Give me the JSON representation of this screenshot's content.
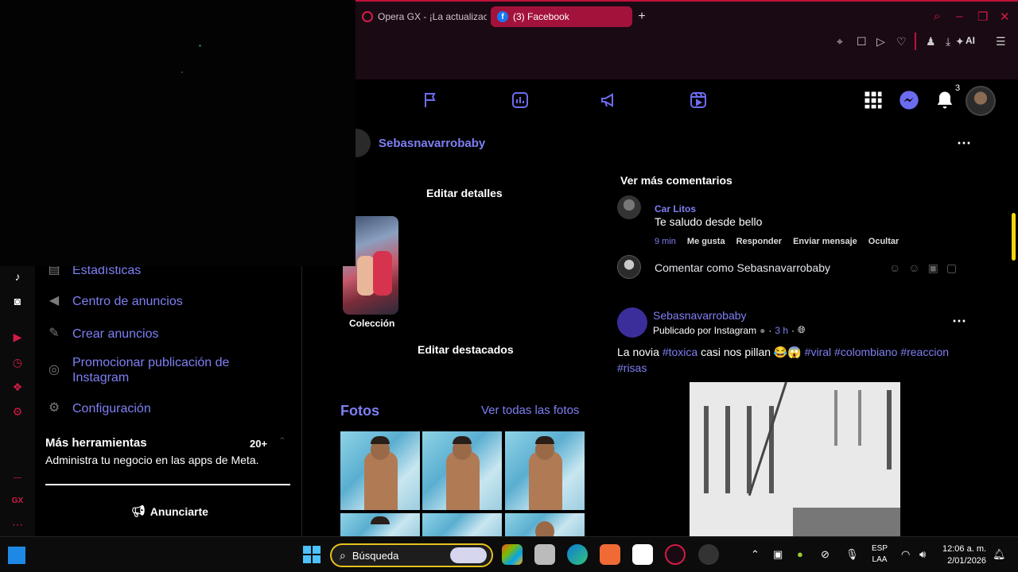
{
  "browser": {
    "tabs": [
      {
        "label": "Opera GX - ¡La actualizació"
      },
      {
        "label": "(3) Facebook",
        "active": true
      }
    ],
    "toolbar_ai_label": "AI",
    "accent_color": "#c0113a"
  },
  "facebook": {
    "nav_icons": [
      "flag-icon",
      "insights-icon",
      "megaphone-icon",
      "reels-icon"
    ],
    "notification_count": "3",
    "profile_name": "Sebasnavarrobaby",
    "edit_details": "Editar detalles",
    "collection_label": "Colección",
    "edit_highlights": "Editar destacados",
    "photos": {
      "title": "Fotos",
      "see_all": "Ver todas las fotos"
    },
    "comments": {
      "see_more": "Ver más comentarios",
      "items": [
        {
          "author": "Car Litos",
          "text": "Te saludo desde bello",
          "time": "9 min",
          "actions": [
            "Me gusta",
            "Responder",
            "Enviar mensaje",
            "Ocultar"
          ]
        }
      ],
      "composer_placeholder": "Comentar como Sebasnavarrobaby"
    },
    "post": {
      "author": "Sebasnavarrobaby",
      "published_by": "Publicado por Instagram",
      "time": "3 h",
      "text_plain_1": "La novia ",
      "tag_1": "#toxica",
      "text_plain_2": " casi nos pillan 😂😱 ",
      "tag_2": "#viral",
      "tag_3": "#colombiano",
      "tag_4": "#reaccion",
      "tag_5": "#risas"
    }
  },
  "left_panel": {
    "items": [
      {
        "label": "Estadísticas",
        "icon": "chart-icon"
      },
      {
        "label": "Centro de anuncios",
        "icon": "megaphone-icon"
      },
      {
        "label": "Crear anuncios",
        "icon": "edit-icon"
      },
      {
        "label": "Promocionar publicación de Instagram",
        "icon": "instagram-icon"
      },
      {
        "label": "Configuración",
        "icon": "gear-icon"
      }
    ],
    "tools_title": "Más herramientas",
    "tools_count": "20+",
    "tools_desc": "Administra tu negocio en las apps de Meta.",
    "advertise_button": "Anunciarte"
  },
  "taskbar": {
    "search_label": "Búsqueda",
    "lang_1": "ESP",
    "lang_2": "LAA",
    "time": "12:06 a. m.",
    "date": "2/01/2026"
  }
}
